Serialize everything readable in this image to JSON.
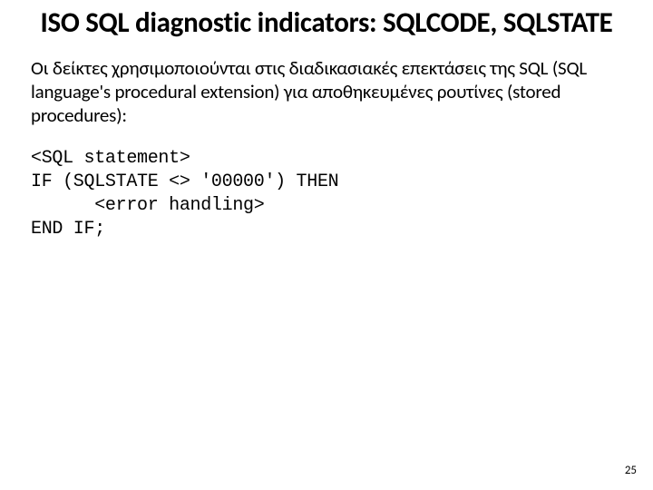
{
  "slide": {
    "title": "ISO SQL diagnostic indicators: SQLCODE, SQLSTATE",
    "body": "Οι δείκτες χρησιμοποιούνται στις διαδικασιακές επεκτάσεις της SQL  (SQL language's procedural extension) για αποθηκευμένες ρουτίνες (stored procedures):",
    "code": {
      "line1": "<SQL statement>",
      "line2": "IF (SQLSTATE <> '00000') THEN",
      "line3": "      <error handling>",
      "line4": "END IF;"
    },
    "page_number": "25"
  }
}
